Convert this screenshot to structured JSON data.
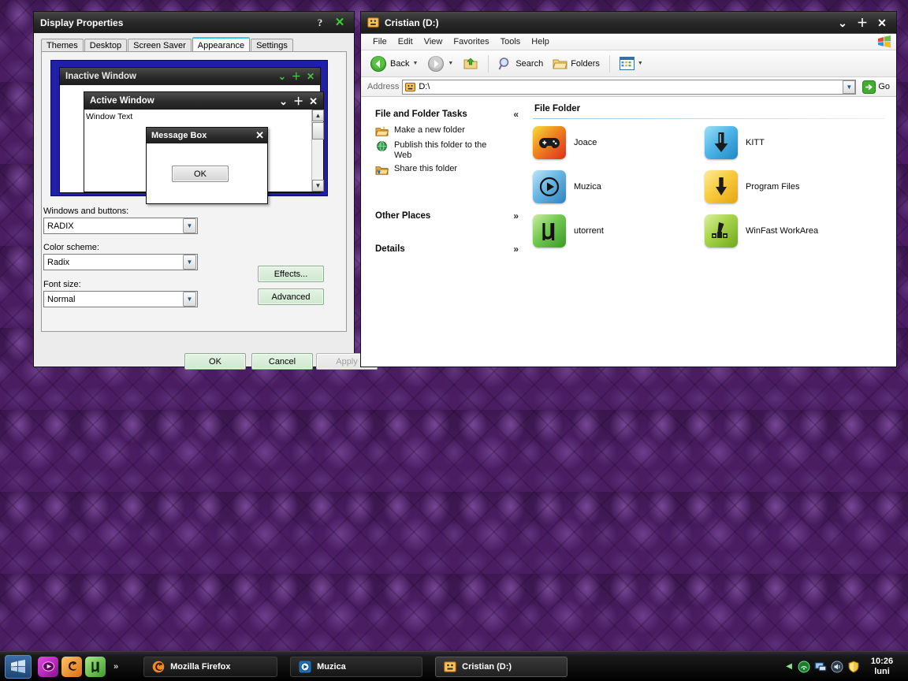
{
  "desktop": {
    "wallpaper_color": "#4a1d63",
    "wallpaper_pattern": "purple-damask"
  },
  "display_properties": {
    "title": "Display Properties",
    "help_button": "?",
    "close_button": "✕",
    "tabs": [
      {
        "label": "Themes",
        "active": false
      },
      {
        "label": "Desktop",
        "active": false
      },
      {
        "label": "Screen Saver",
        "active": false
      },
      {
        "label": "Appearance",
        "active": true
      },
      {
        "label": "Settings",
        "active": false
      }
    ],
    "preview": {
      "inactive_window_title": "Inactive Window",
      "active_window_title": "Active Window",
      "window_text": "Window Text",
      "message_box_title": "Message Box",
      "message_box_close": "✕",
      "ok_button": "OK",
      "inactive_minimize": "⌄",
      "inactive_maximize": "＋",
      "inactive_close": "✕",
      "active_minimize": "⌄",
      "active_maximize": "＋",
      "active_close": "✕",
      "scroll_up": "▲",
      "scroll_down": "▼"
    },
    "fields": {
      "windows_and_buttons_label": "Windows and buttons:",
      "windows_and_buttons_value": "RADIX",
      "color_scheme_label": "Color scheme:",
      "color_scheme_value": "Radix",
      "font_size_label": "Font size:",
      "font_size_value": "Normal"
    },
    "buttons": {
      "effects": "Effects...",
      "advanced": "Advanced",
      "ok": "OK",
      "cancel": "Cancel",
      "apply": "Apply"
    }
  },
  "explorer": {
    "title": "Cristian (D:)",
    "minimize": "⌄",
    "maximize": "＋",
    "close": "✕",
    "menus": [
      "File",
      "Edit",
      "View",
      "Favorites",
      "Tools",
      "Help"
    ],
    "toolbar": {
      "back": "Back",
      "forward": "",
      "up": "",
      "search": "Search",
      "folders": "Folders",
      "views": ""
    },
    "address": {
      "label": "Address",
      "value": "D:\\",
      "go": "Go"
    },
    "task_pane": {
      "file_and_folder_tasks": {
        "title": "File and Folder Tasks",
        "chevron": "«",
        "links": [
          {
            "label": "Make a new folder",
            "icon": "new-folder-icon"
          },
          {
            "label": "Publish this folder to the Web",
            "icon": "globe-icon"
          },
          {
            "label": "Share this folder",
            "icon": "share-folder-icon"
          }
        ]
      },
      "other_places": {
        "title": "Other Places",
        "chevron": "»"
      },
      "details": {
        "title": "Details",
        "chevron": "»"
      }
    },
    "content": {
      "group_title": "File Folder",
      "items": [
        {
          "name": "Joace",
          "icon": "gamepad-icon",
          "color": "#e8352a",
          "color2": "#f7d52e"
        },
        {
          "name": "KITT",
          "icon": "download-arrow-icon",
          "color": "#49b9e8",
          "color2": "#8ad7f5"
        },
        {
          "name": "Muzica",
          "icon": "play-circle-icon",
          "color": "#57a9dd",
          "color2": "#9bd0ef"
        },
        {
          "name": "Program Files",
          "icon": "down-arrow-icon",
          "color": "#f5c521",
          "color2": "#fde47a"
        },
        {
          "name": "utorrent",
          "icon": "mu-icon",
          "color": "#57c24a",
          "color2": "#a8e38f"
        },
        {
          "name": "WinFast WorkArea",
          "icon": "tv-tuner-icon",
          "color": "#9ac93a",
          "color2": "#c8e37c"
        }
      ]
    }
  },
  "taskbar": {
    "start_label": "start",
    "quick_launch": [
      {
        "name": "media-player-icon",
        "color": "#c21fb8"
      },
      {
        "name": "firefox-icon",
        "color": "#f08a24"
      },
      {
        "name": "utorrent-icon",
        "color": "#5fc04a"
      }
    ],
    "quick_launch_more": "»",
    "tasks": [
      {
        "label": "Mozilla Firefox",
        "icon": "firefox-icon",
        "active": false
      },
      {
        "label": "Muzica",
        "icon": "media-player-icon",
        "active": false
      },
      {
        "label": "Cristian (D:)",
        "icon": "drive-icon",
        "active": true
      }
    ],
    "tray": {
      "chevron": "◀",
      "icons": [
        "network-icon",
        "monitor-icon",
        "volume-icon",
        "shield-icon"
      ],
      "time": "10:26",
      "day": "luni"
    }
  }
}
